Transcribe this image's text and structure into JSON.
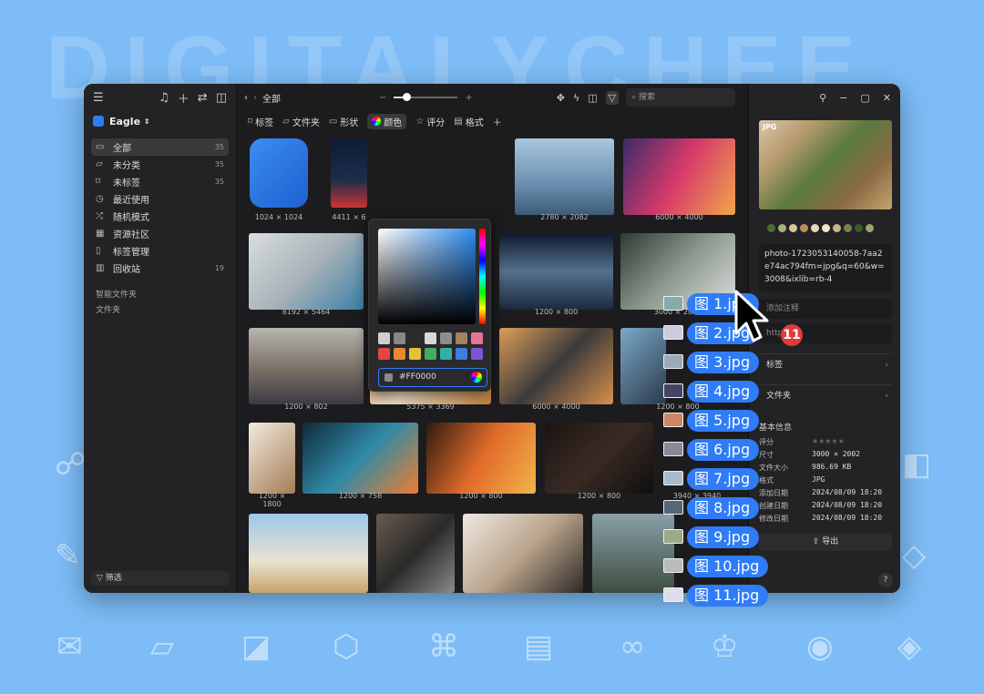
{
  "background": {
    "word": "DIGITALYCHEE",
    "color": "#7dbcf6"
  },
  "sidebar": {
    "library": "Eagle",
    "items": [
      {
        "icon": "inbox-icon",
        "glyph": "▭",
        "label": "全部",
        "count": "35"
      },
      {
        "icon": "folder-icon",
        "glyph": "▱",
        "label": "未分类",
        "count": "35"
      },
      {
        "icon": "tag-off-icon",
        "glyph": "⌑",
        "label": "未标签",
        "count": "35"
      },
      {
        "icon": "clock-icon",
        "glyph": "◷",
        "label": "最近使用",
        "count": ""
      },
      {
        "icon": "shuffle-icon",
        "glyph": "⤮",
        "label": "随机模式",
        "count": ""
      },
      {
        "icon": "community-icon",
        "glyph": "▦",
        "label": "资源社区",
        "count": ""
      },
      {
        "icon": "bookmark-icon",
        "glyph": "▯",
        "label": "标签管理",
        "count": ""
      },
      {
        "icon": "trash-icon",
        "glyph": "▥",
        "label": "回收站",
        "count": "19"
      }
    ],
    "smart_folders": "智能文件夹",
    "folders": "文件夹",
    "filter": "筛选"
  },
  "toolbar": {
    "title": "全部",
    "search_placeholder": "搜索",
    "zoom": 0.2
  },
  "filterbar": [
    {
      "icon": "tag-icon",
      "glyph": "⌑",
      "label": "标签"
    },
    {
      "icon": "folder-icon",
      "glyph": "▱",
      "label": "文件夹"
    },
    {
      "icon": "shape-icon",
      "glyph": "▭",
      "label": "形状"
    },
    {
      "icon": "color-wheel-icon",
      "glyph": "",
      "label": "颜色"
    },
    {
      "icon": "star-icon",
      "glyph": "☆",
      "label": "评分"
    },
    {
      "icon": "format-icon",
      "glyph": "▤",
      "label": "格式"
    }
  ],
  "grid": [
    {
      "dim": "1024 × 1024"
    },
    {
      "dim": "4411 × 6"
    },
    {
      "dim": "2780 × 2082"
    },
    {
      "dim": "6000 × 4000"
    },
    {
      "dim": "8192 × 5464"
    },
    {
      "dim": "8192 × 5464"
    },
    {
      "dim": "1200 × 800"
    },
    {
      "dim": "3000 × 2000"
    },
    {
      "dim": "1200 × 802"
    },
    {
      "dim": "5375 × 3369"
    },
    {
      "dim": "6000 × 4000"
    },
    {
      "dim": "1200 × 800"
    },
    {
      "dim": "1200 × 1800"
    },
    {
      "dim": "1200 × 758"
    },
    {
      "dim": "1200 × 800"
    },
    {
      "dim": "1200 × 800"
    },
    {
      "dim": "3940 × 3940"
    },
    {
      "dim": ""
    },
    {
      "dim": ""
    },
    {
      "dim": ""
    },
    {
      "dim": ""
    }
  ],
  "color_picker": {
    "hex": "#FF0000",
    "swatches": [
      "#cfcfcf",
      "#888888",
      "#2b2b2b",
      "#d8d8d8",
      "#8d8d8d",
      "#a08264",
      "#e8739a",
      "#e04747",
      "#e8892f",
      "#e2c23a",
      "#3fae63",
      "#2fb2a6",
      "#3b7de0",
      "#7b55d6"
    ]
  },
  "inspector": {
    "type": "JPG",
    "palette": [
      "#4f6b34",
      "#a9b180",
      "#d8c69a",
      "#b98e5b",
      "#e7d8b5",
      "#f1e7c9",
      "#c8b58a",
      "#7a8447",
      "#3f5a2a",
      "#9ba86a"
    ],
    "filename": "photo-1723053140058-7aa2e74ac794fm=jpg&q=60&w=3008&ixlib=rb-4",
    "note_placeholder": "添加注释",
    "url_placeholder": "http",
    "tags_label": "标签",
    "folder_label": "文件夹",
    "meta_title": "基本信息",
    "meta": [
      {
        "key": "评分",
        "value": "★★★★★"
      },
      {
        "key": "尺寸",
        "value": "3000 × 2002"
      },
      {
        "key": "文件大小",
        "value": "986.69 KB"
      },
      {
        "key": "格式",
        "value": "JPG"
      },
      {
        "key": "添加日期",
        "value": "2024/08/09 18:20"
      },
      {
        "key": "创建日期",
        "value": "2024/08/09 18:20"
      },
      {
        "key": "修改日期",
        "value": "2024/08/09 18:20"
      }
    ],
    "export": "导出",
    "help": "?"
  },
  "drag": {
    "count": "11",
    "files": [
      "图 1.jpg",
      "图 2.jpg",
      "图 3.jpg",
      "图 4.jpg",
      "图 5.jpg",
      "图 6.jpg",
      "图 7.jpg",
      "图 8.jpg",
      "图 9.jpg",
      "图 10.jpg",
      "图 11.jpg"
    ]
  }
}
